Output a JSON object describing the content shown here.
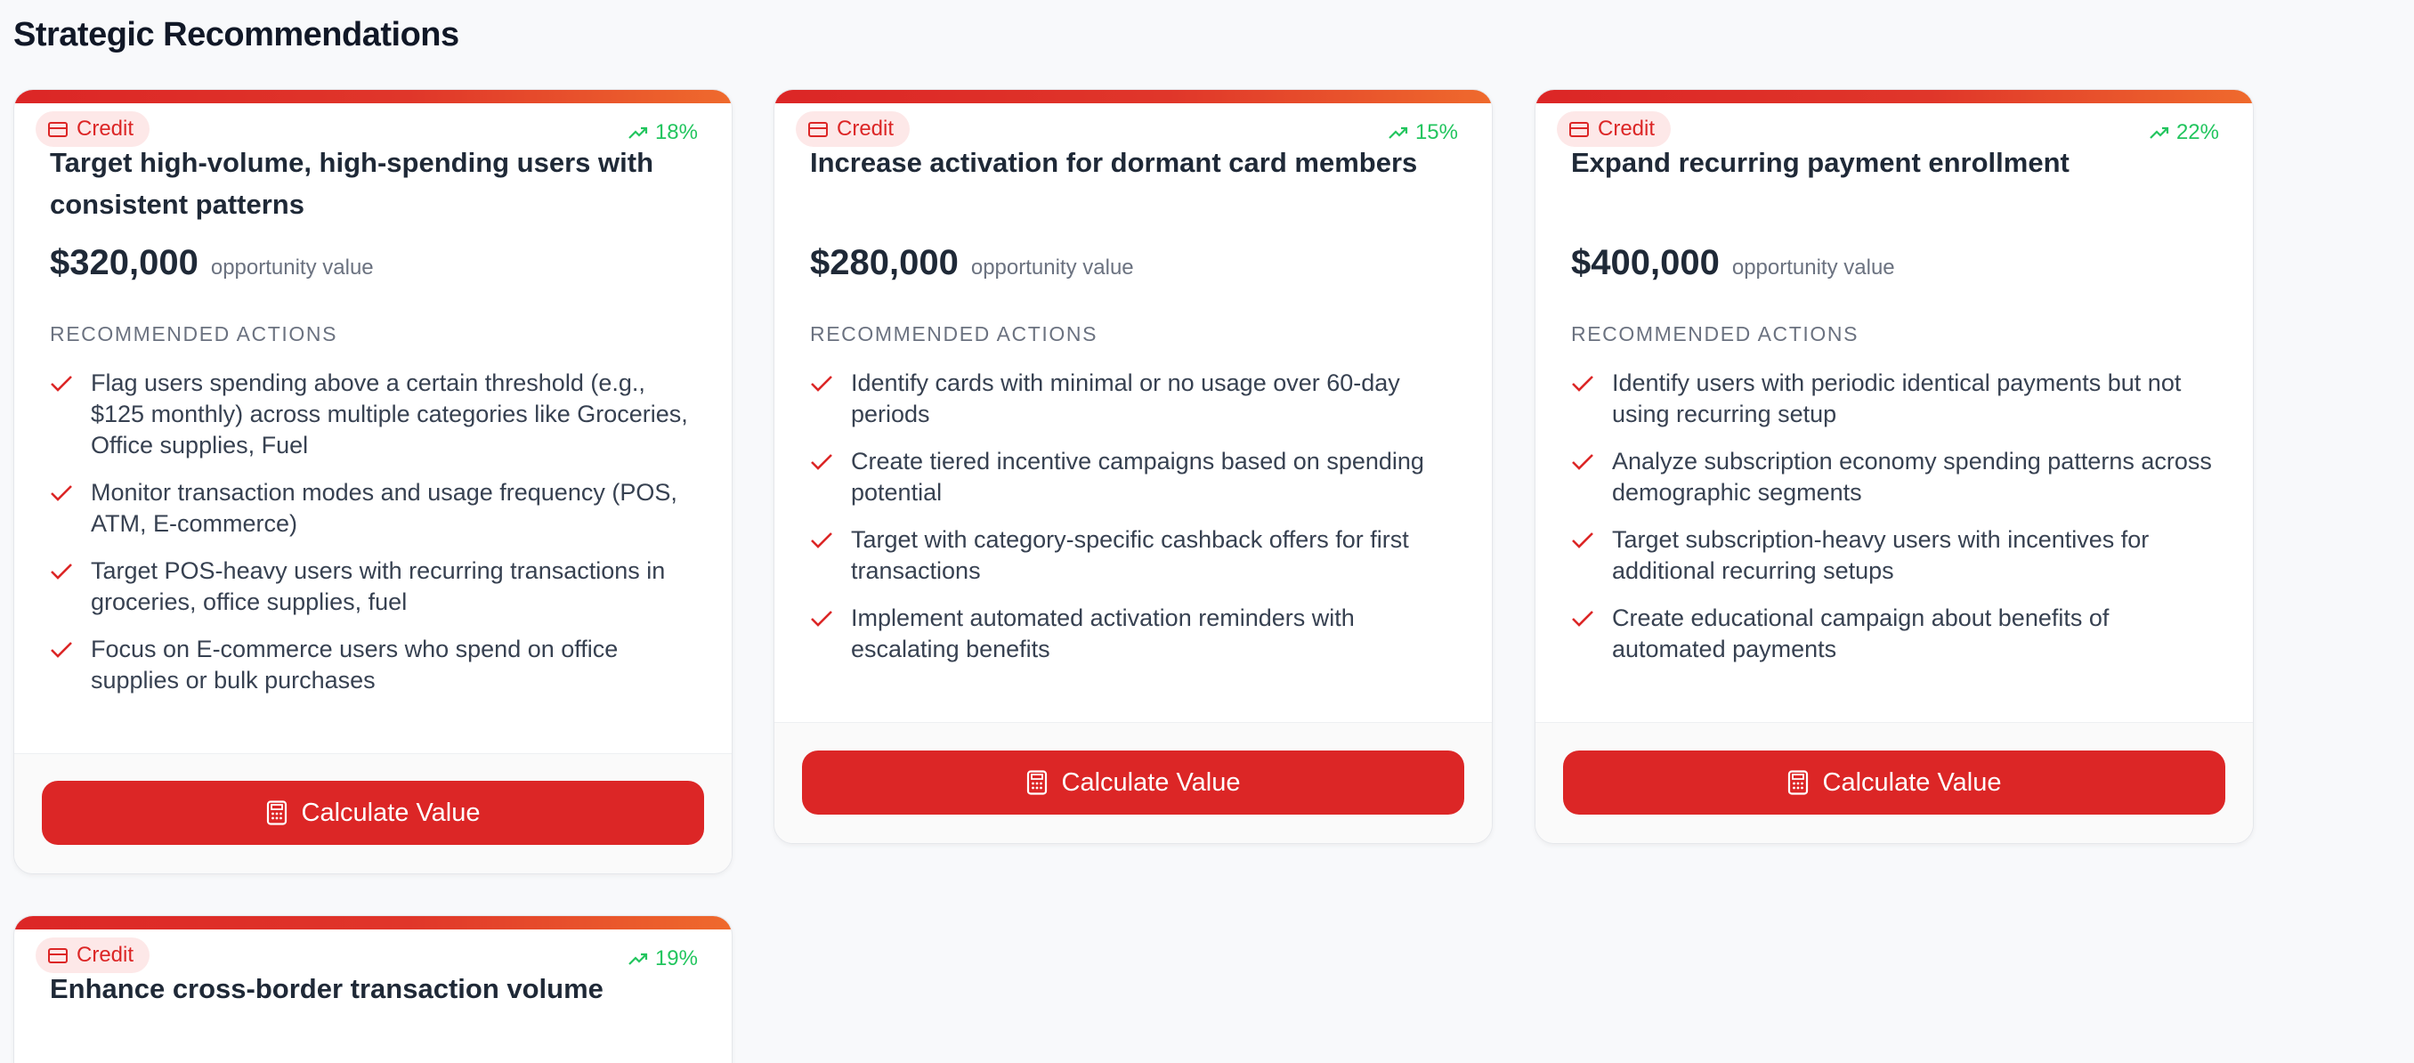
{
  "section": {
    "title": "Strategic Recommendations"
  },
  "common": {
    "opportunity_label": "opportunity value",
    "actions_heading": "RECOMMENDED ACTIONS",
    "button_label": "Calculate Value",
    "badge_icon": "credit-card-icon",
    "growth_icon": "trending-up-icon",
    "button_icon": "calculator-icon"
  },
  "colors": {
    "accent": "#dc2626",
    "accent_end": "#ef6a2d",
    "growth": "#22c55e",
    "badge_bg": "#fde8e8"
  },
  "cards": [
    {
      "badge": "Credit",
      "growth": "18%",
      "title": "Target high-volume, high-spending users with consistent patterns",
      "value": "$320,000",
      "actions": [
        "Flag users spending above a certain threshold (e.g., $125 monthly) across multiple categories like Groceries, Office supplies, Fuel",
        "Monitor transaction modes and usage frequency (POS, ATM, E-commerce)",
        "Target POS-heavy users with recurring transactions in groceries, office supplies, fuel",
        "Focus on E-commerce users who spend on office supplies or bulk purchases"
      ]
    },
    {
      "badge": "Credit",
      "growth": "15%",
      "title": "Increase activation for dormant card members",
      "value": "$280,000",
      "actions": [
        "Identify cards with minimal or no usage over 60-day periods",
        "Create tiered incentive campaigns based on spending potential",
        "Target with category-specific cashback offers for first transactions",
        "Implement automated activation reminders with escalating benefits"
      ]
    },
    {
      "badge": "Credit",
      "growth": "22%",
      "title": "Expand recurring payment enrollment",
      "value": "$400,000",
      "actions": [
        "Identify users with periodic identical payments but not using recurring setup",
        "Analyze subscription economy spending patterns across demographic segments",
        "Target subscription-heavy users with incentives for additional recurring setups",
        "Create educational campaign about benefits of automated payments"
      ]
    },
    {
      "badge": "Credit",
      "growth": "19%",
      "title": "Enhance cross-border transaction volume"
    }
  ]
}
